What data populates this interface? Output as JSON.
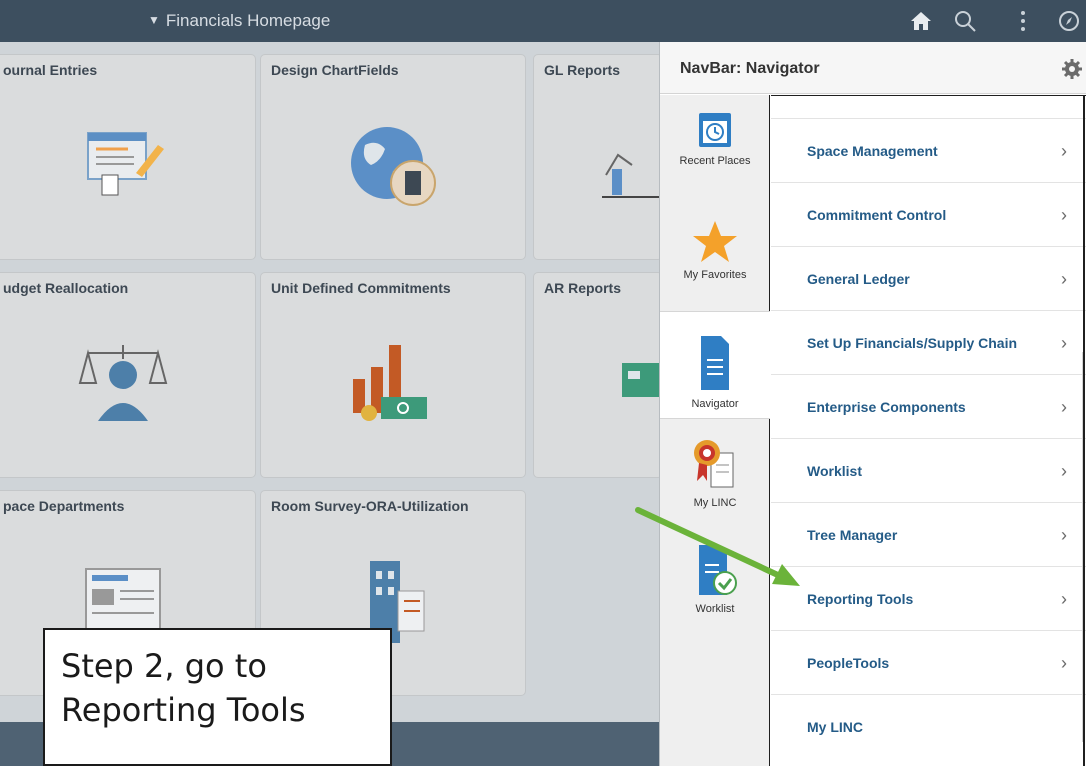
{
  "topbar": {
    "title": "Financials Homepage",
    "icons": [
      "home-icon",
      "search-icon",
      "more-vertical-icon",
      "navigator-compass-icon"
    ]
  },
  "tiles": [
    {
      "title": "ournal Entries",
      "icon": "journal-entry-icon"
    },
    {
      "title": "Design ChartFields",
      "icon": "globe-building-icon"
    },
    {
      "title": "GL Reports",
      "icon": "line-chart-icon"
    },
    {
      "title": "udget Reallocation",
      "icon": "scales-person-icon"
    },
    {
      "title": "Unit Defined Commitments",
      "icon": "bar-chart-money-icon"
    },
    {
      "title": "AR Reports",
      "icon": "money-report-icon"
    },
    {
      "title": "pace Departments",
      "icon": "document-list-icon"
    },
    {
      "title": "Room Survey-ORA-Utilization",
      "icon": "building-list-icon"
    }
  ],
  "nav": {
    "title": "NavBar: Navigator",
    "sidebar": [
      {
        "label": "Recent Places",
        "icon": "calendar-clock-icon"
      },
      {
        "label": "My Favorites",
        "icon": "star-icon"
      },
      {
        "label": "Navigator",
        "icon": "document-icon"
      },
      {
        "label": "My LINC",
        "icon": "ribbon-award-icon"
      },
      {
        "label": "Worklist",
        "icon": "worklist-check-icon"
      }
    ],
    "items": [
      {
        "label": "Space Management",
        "chevron": "›"
      },
      {
        "label": "Commitment Control",
        "chevron": "›"
      },
      {
        "label": "General Ledger",
        "chevron": "›"
      },
      {
        "label": "Set Up Financials/Supply Chain",
        "chevron": "›"
      },
      {
        "label": "Enterprise Components",
        "chevron": "›"
      },
      {
        "label": "Worklist",
        "chevron": "›"
      },
      {
        "label": "Tree Manager",
        "chevron": "›"
      },
      {
        "label": "Reporting Tools",
        "chevron": "›"
      },
      {
        "label": "PeopleTools",
        "chevron": "›"
      },
      {
        "label": "My LINC",
        "chevron": ""
      }
    ]
  },
  "callout": {
    "line1": "Step 2, go to",
    "line2": "Reporting Tools"
  },
  "colors": {
    "topbar": "#3d4f5f",
    "nav_link": "#245b87",
    "arrow": "#6bb33a"
  }
}
